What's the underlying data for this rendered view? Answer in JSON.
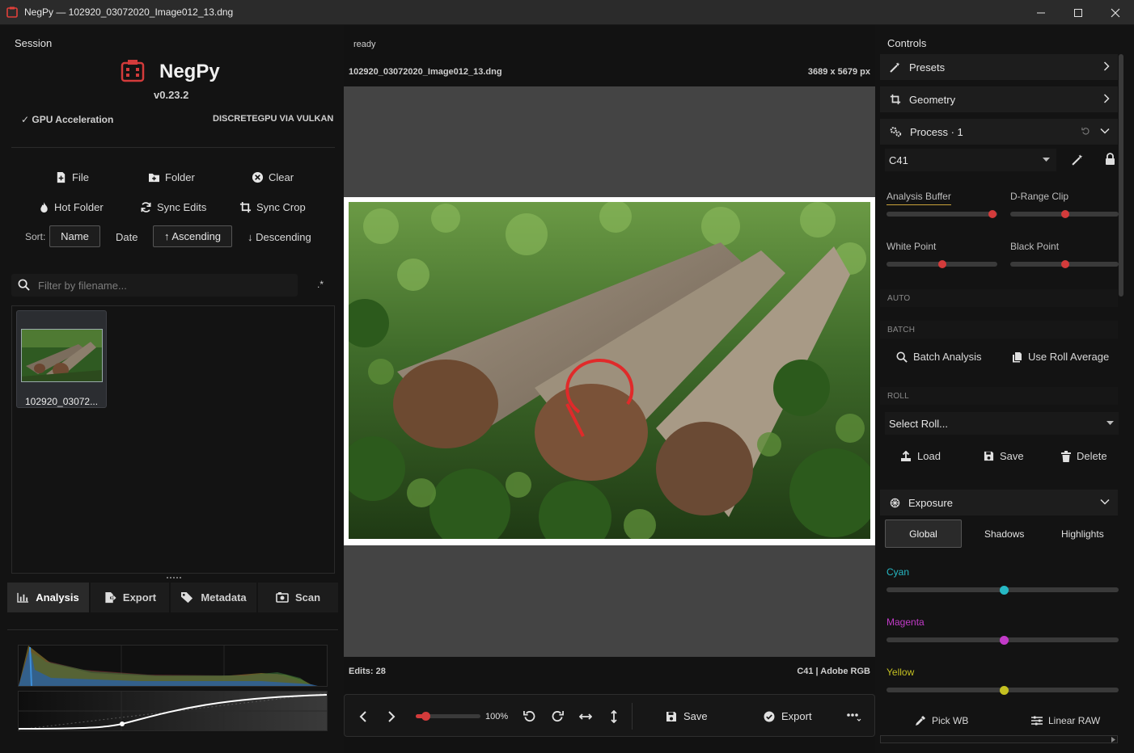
{
  "window": {
    "title": "NegPy — 102920_03072020_Image012_13.dng"
  },
  "left": {
    "section_label": "Session",
    "app_name": "NegPy",
    "version": "v0.23.2",
    "gpu_label": "✓ GPU Acceleration",
    "gpu_value": "DISCRETEGPU VIA VULKAN",
    "buttons": {
      "file": "File",
      "folder": "Folder",
      "clear": "Clear",
      "hot_folder": "Hot Folder",
      "sync_edits": "Sync Edits",
      "sync_crop": "Sync Crop"
    },
    "sort": {
      "label": "Sort:",
      "name": "Name",
      "date": "Date",
      "ascending": "↑ Ascending",
      "descending": "↓ Descending"
    },
    "search": {
      "placeholder": "Filter by filename...",
      "regex": ".*"
    },
    "files": [
      {
        "label": "102920_03072..."
      }
    ],
    "tabs": {
      "analysis": "Analysis",
      "export": "Export",
      "metadata": "Metadata",
      "scan": "Scan"
    }
  },
  "center": {
    "status": "ready",
    "filename": "102920_03072020_Image012_13.dng",
    "dimensions": "3689 x 5679 px",
    "edits": "Edits: 28",
    "profile": "C41 | Adobe RGB",
    "toolbar": {
      "zoom": "100%",
      "save": "Save",
      "export": "Export"
    }
  },
  "right": {
    "title": "Controls",
    "sections": {
      "presets": "Presets",
      "geometry": "Geometry",
      "process": "Process · 1",
      "exposure": "Exposure"
    },
    "process_mode": "C41",
    "sliders": {
      "analysis_buffer": "Analysis Buffer",
      "d_range_clip": "D-Range Clip",
      "white_point": "White Point",
      "black_point": "Black Point"
    },
    "captions": {
      "auto": "AUTO",
      "batch": "BATCH",
      "roll": "ROLL"
    },
    "batch": {
      "analysis": "Batch Analysis",
      "roll_average": "Use Roll Average"
    },
    "roll": {
      "select": "Select Roll...",
      "load": "Load",
      "save": "Save",
      "delete": "Delete"
    },
    "exposure_tabs": {
      "global": "Global",
      "shadows": "Shadows",
      "highlights": "Highlights"
    },
    "color": {
      "cyan": "Cyan",
      "magenta": "Magenta",
      "yellow": "Yellow"
    },
    "bottom": {
      "pick_wb": "Pick WB",
      "linear_raw": "Linear RAW"
    }
  },
  "colors": {
    "accent_red": "#d33b3b",
    "cyan": "#26b8c4",
    "magenta": "#c23ac8",
    "yellow": "#c4c021"
  }
}
